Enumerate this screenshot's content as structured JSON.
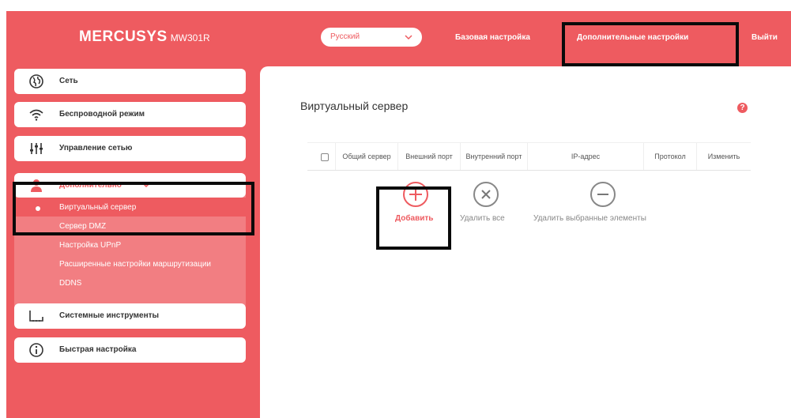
{
  "header": {
    "brand": "MERCUSYS",
    "model": "MW301R",
    "language": "Русский",
    "nav": {
      "basic": "Базовая настройка",
      "advanced": "Дополнительные настройки",
      "logout": "Выйти"
    }
  },
  "sidebar": {
    "items": {
      "network": {
        "label": "Сеть",
        "icon": "globe-icon"
      },
      "wireless": {
        "label": "Беспроводной режим",
        "icon": "wifi-icon"
      },
      "control": {
        "label": "Управление сетью",
        "icon": "sliders-icon"
      },
      "advanced": {
        "label": "Дополнительно",
        "icon": "user-icon"
      },
      "tools": {
        "label": "Системные инструменты",
        "icon": "router-icon"
      },
      "quick": {
        "label": "Быстрая настройка",
        "icon": "info-icon"
      }
    },
    "advanced_submenu": {
      "virtual_server": "Виртуальный сервер",
      "dmz": "Сервер DMZ",
      "upnp": "Настройка UPnP",
      "routing": "Расширенные настройки маршрутизации",
      "ddns": "DDNS"
    }
  },
  "main": {
    "title": "Виртуальный сервер",
    "table_columns": {
      "service": "Общий сервер",
      "ext_port": "Внешний порт",
      "int_port": "Внутренний порт",
      "ip": "IP-адрес",
      "protocol": "Протокол",
      "edit": "Изменить"
    },
    "actions": {
      "add": "Добавить",
      "delete_all": "Удалить все",
      "delete_selected": "Удалить выбранные элементы"
    }
  },
  "colors": {
    "accent": "#ee5b60",
    "submenu_bg": "#f27e82",
    "highlight_box": "#0a0a0a"
  }
}
